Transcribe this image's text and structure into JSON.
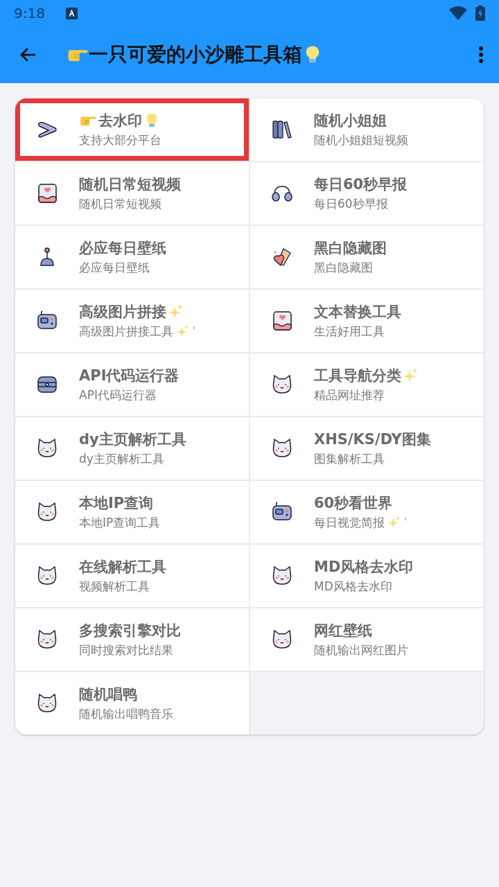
{
  "status_bar": {
    "time": "9:18"
  },
  "app_bar": {
    "title": "一只可爱的小沙雕工具箱"
  },
  "tools": [
    {
      "kind": "play",
      "title": "去水印",
      "subtitle": "支持大部分平台",
      "selected": true
    },
    {
      "kind": "books",
      "title": "随机小姐姐",
      "subtitle": "随机小姐姐短视频",
      "selected": false
    },
    {
      "kind": "notebook",
      "title": "随机日常短视频",
      "subtitle": "随机日常短视频",
      "selected": false
    },
    {
      "kind": "headphones",
      "title": "每日60秒早报",
      "subtitle": "每日60秒早报",
      "selected": false
    },
    {
      "kind": "joystick",
      "title": "必应每日壁纸",
      "subtitle": "必应每日壁纸",
      "selected": false
    },
    {
      "kind": "eraser",
      "title": "黑白隐藏图",
      "subtitle": "黑白隐藏图",
      "selected": false
    },
    {
      "kind": "radio",
      "title": "高级图片拼接",
      "subtitle": "高级图片拼接工具",
      "subtitle_tail": "'",
      "selected": false
    },
    {
      "kind": "notebook",
      "title": "文本替换工具",
      "subtitle": "生活好用工具",
      "selected": false
    },
    {
      "kind": "server",
      "title": "API代码运行器",
      "subtitle": "API代码运行器",
      "selected": false
    },
    {
      "kind": "cat",
      "title": "工具导航分类",
      "subtitle": "精品网址推荐",
      "selected": false
    },
    {
      "kind": "cat",
      "title": "dy主页解析工具",
      "subtitle": "dy主页解析工具",
      "selected": false
    },
    {
      "kind": "cat",
      "title": "XHS/KS/DY图集",
      "subtitle": "图集解析工具",
      "selected": false
    },
    {
      "kind": "cat",
      "title": "本地IP查询",
      "subtitle": "本地IP查询工具",
      "selected": false
    },
    {
      "kind": "radio",
      "title": "60秒看世界",
      "subtitle": "每日视觉简报",
      "subtitle_tail": "'",
      "selected": false
    },
    {
      "kind": "cat",
      "title": "在线解析工具",
      "subtitle": "视频解析工具",
      "selected": false
    },
    {
      "kind": "cat",
      "title": "MD风格去水印",
      "subtitle": "MD风格去水印",
      "selected": false
    },
    {
      "kind": "cat",
      "title": "多搜索引擎对比",
      "subtitle": "同时搜索对比结果",
      "selected": false
    },
    {
      "kind": "cat",
      "title": "网红壁纸",
      "subtitle": "随机输出网红图片",
      "selected": false
    },
    {
      "kind": "cat",
      "title": "随机唱鸭",
      "subtitle": "随机输出唱鸭音乐",
      "selected": false
    }
  ]
}
